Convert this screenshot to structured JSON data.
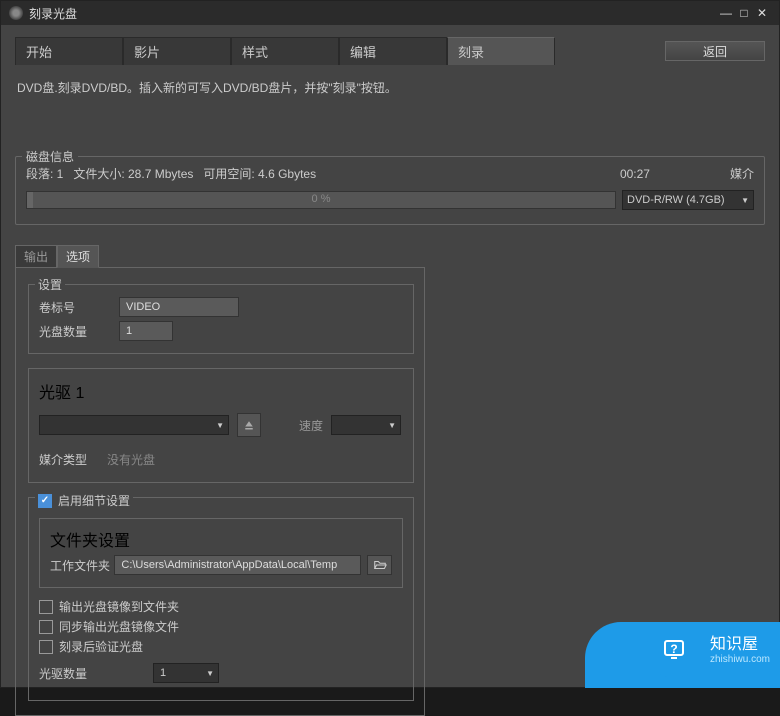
{
  "window": {
    "title": "刻录光盘"
  },
  "tabs": [
    "开始",
    "影片",
    "样式",
    "编辑",
    "刻录"
  ],
  "return_btn": "返回",
  "instruction": "DVD盘.刻录DVD/BD。插入新的可写入DVD/BD盘片，并按\"刻录\"按钮。",
  "disc_info": {
    "legend": "磁盘信息",
    "segments": "段落: 1",
    "filesize": "文件大小: 28.7 Mbytes",
    "freespace": "可用空间: 4.6 Gbytes",
    "time": "00:27",
    "media_label": "媒介",
    "progress_pct": "0 %",
    "media_select": "DVD-R/RW (4.7GB)"
  },
  "sub_tabs": {
    "output": "输出",
    "options": "选项"
  },
  "settings": {
    "legend": "设置",
    "volume_label": "卷标号",
    "volume_value": "VIDEO",
    "count_label": "光盘数量",
    "count_value": "1"
  },
  "drive": {
    "legend": "光驱 1",
    "speed_label": "速度",
    "media_type_label": "媒介类型",
    "media_type_value": "没有光盘"
  },
  "detail": {
    "enable": "启用细节设置",
    "folder_legend": "文件夹设置",
    "work_folder_label": "工作文件夹",
    "work_folder_value": "C:\\Users\\Administrator\\AppData\\Local\\Temp",
    "cb1": "输出光盘镜像到文件夹",
    "cb2": "同步输出光盘镜像文件",
    "cb3": "刻录后验证光盘",
    "drive_count_label": "光驱数量",
    "drive_count_value": "1"
  },
  "watermark": {
    "brand": "知识屋",
    "url": "zhishiwu.com"
  }
}
